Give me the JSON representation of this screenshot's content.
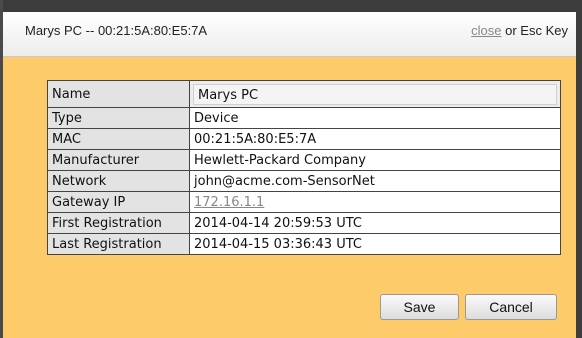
{
  "dialog": {
    "title": "Marys PC -- 00:21:5A:80:E5:7A",
    "close_link": "close",
    "close_hint": "or Esc Key"
  },
  "details": [
    {
      "label": "Name",
      "value": "Marys PC"
    },
    {
      "label": "Type",
      "value": "Device"
    },
    {
      "label": "MAC",
      "value": "00:21:5A:80:E5:7A"
    },
    {
      "label": "Manufacturer",
      "value": "Hewlett-Packard Company"
    },
    {
      "label": "Network",
      "value": "john@acme.com-SensorNet"
    },
    {
      "label": "Gateway IP",
      "value": "172.16.1.1"
    },
    {
      "label": "First Registration",
      "value": "2014-04-14 20:59:53 UTC"
    },
    {
      "label": "Last Registration",
      "value": "2014-04-15 03:36:43 UTC"
    }
  ],
  "buttons": {
    "save": "Save",
    "cancel": "Cancel"
  }
}
